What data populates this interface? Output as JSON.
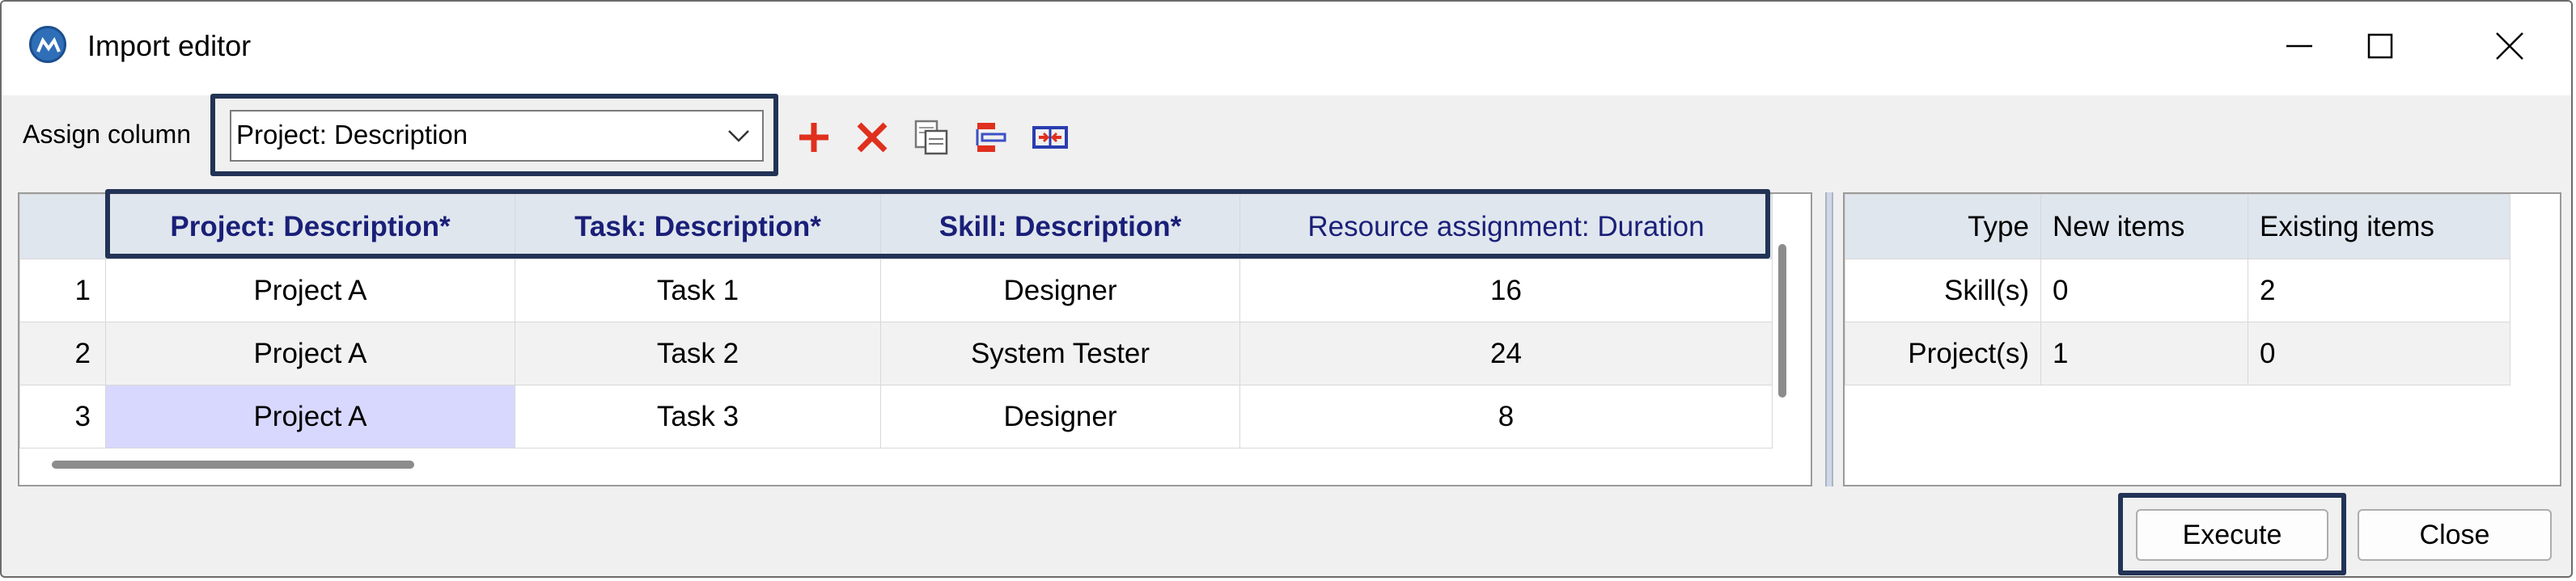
{
  "window": {
    "title": "Import editor"
  },
  "toolbar": {
    "assign_label": "Assign column",
    "assign_value": "Project: Description",
    "buttons": [
      "add-icon",
      "delete-icon",
      "copy-icon",
      "map-columns-icon",
      "merge-icon"
    ]
  },
  "grid": {
    "columns": [
      {
        "label": "Project: Description*",
        "bold": true
      },
      {
        "label": "Task: Description*",
        "bold": true
      },
      {
        "label": "Skill: Description*",
        "bold": true
      },
      {
        "label": "Resource assignment: Duration",
        "bold": false
      }
    ],
    "rows": [
      {
        "num": "1",
        "project": "Project A",
        "task": "Task 1",
        "skill": "Designer",
        "duration": "16"
      },
      {
        "num": "2",
        "project": "Project A",
        "task": "Task 2",
        "skill": "System Tester",
        "duration": "24"
      },
      {
        "num": "3",
        "project": "Project A",
        "task": "Task 3",
        "skill": "Designer",
        "duration": "8"
      }
    ]
  },
  "summary": {
    "headers": [
      "Type",
      "New items",
      "Existing items"
    ],
    "rows": [
      {
        "type": "Skill(s)",
        "new": "0",
        "existing": "2"
      },
      {
        "type": "Project(s)",
        "new": "1",
        "existing": "0"
      }
    ]
  },
  "footer": {
    "execute_label": "Execute",
    "close_label": "Close"
  },
  "colors": {
    "header_text": "#1a1f78",
    "highlight_border": "#223355",
    "selected_cell": "#d8d8ff",
    "header_bg": "#dfe6ee"
  }
}
